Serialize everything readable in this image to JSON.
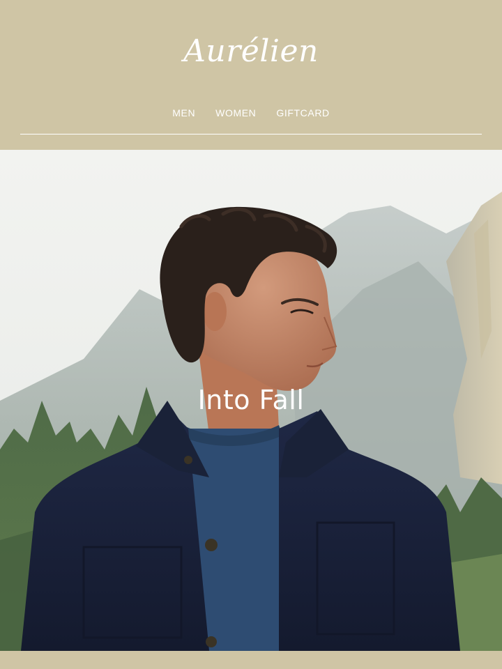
{
  "brand": {
    "logo_text": "Aurélien"
  },
  "nav": {
    "items": [
      "MEN",
      "WOMEN",
      "GIFTCARD"
    ]
  },
  "hero": {
    "title": "Into Fall"
  },
  "colors": {
    "header_bg": "#cfc5a5",
    "text": "#ffffff",
    "jacket": "#1c2540",
    "sweater": "#2e4c72"
  }
}
